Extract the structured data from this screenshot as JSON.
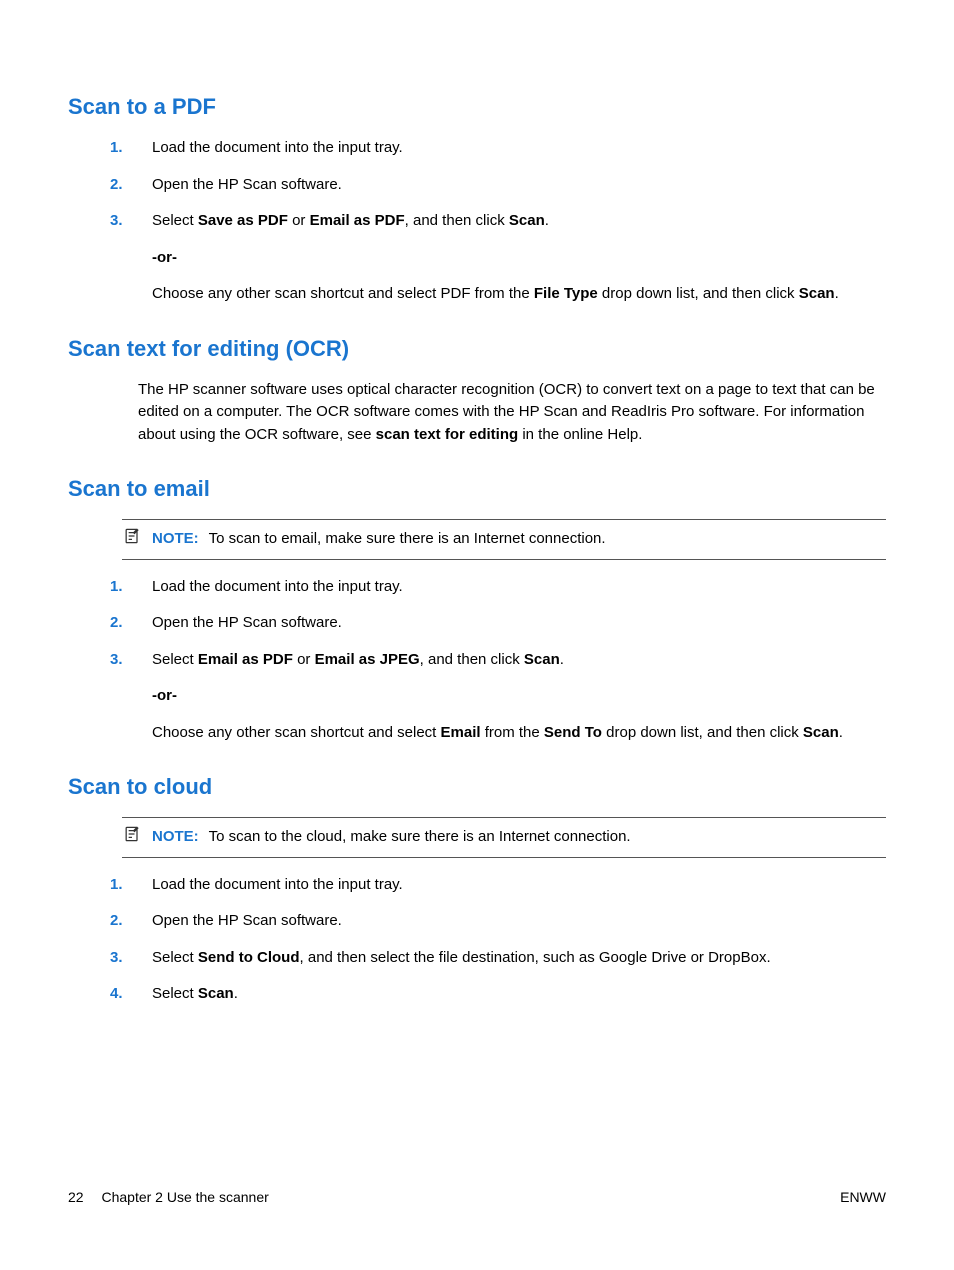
{
  "sections": {
    "pdf": {
      "title": "Scan to a PDF",
      "steps": {
        "s1": "Load the document into the input tray.",
        "s2": "Open the HP Scan software.",
        "s3_1": "Select ",
        "s3_b1": "Save as PDF",
        "s3_2": " or ",
        "s3_b2": "Email as PDF",
        "s3_3": ", and then click ",
        "s3_b3": "Scan",
        "s3_4": "."
      },
      "or": "-or-",
      "alt_1": "Choose any other scan shortcut and select PDF from the ",
      "alt_b1": "File Type",
      "alt_2": " drop down list, and then click ",
      "alt_b2": "Scan",
      "alt_3": "."
    },
    "ocr": {
      "title": "Scan text for editing (OCR)",
      "p1": "The HP scanner software uses optical character recognition (OCR) to convert text on a page to text that can be edited on a computer. The OCR software comes with the HP Scan and ReadIris Pro software. For information about using the OCR software, see ",
      "p1_b": "scan text for editing",
      "p2": " in the online Help."
    },
    "email": {
      "title": "Scan to email",
      "note_label": "NOTE:",
      "note_text": "To scan to email, make sure there is an Internet connection.",
      "steps": {
        "s1": "Load the document into the input tray.",
        "s2": "Open the HP Scan software.",
        "s3_1": "Select ",
        "s3_b1": "Email as PDF",
        "s3_2": " or ",
        "s3_b2": "Email as JPEG",
        "s3_3": ", and then click ",
        "s3_b3": "Scan",
        "s3_4": "."
      },
      "or": "-or-",
      "alt_1": "Choose any other scan shortcut and select ",
      "alt_b1": "Email",
      "alt_2": " from the ",
      "alt_b2": "Send To",
      "alt_3": " drop down list, and then click ",
      "alt_b3": "Scan",
      "alt_4": "."
    },
    "cloud": {
      "title": "Scan to cloud",
      "note_label": "NOTE:",
      "note_text": "To scan to the cloud, make sure there is an Internet connection.",
      "steps": {
        "s1": "Load the document into the input tray.",
        "s2": "Open the HP Scan software.",
        "s3_1": "Select ",
        "s3_b1": "Send to Cloud",
        "s3_2": ", and then select the file destination, such as Google Drive or DropBox.",
        "s4_1": "Select ",
        "s4_b1": "Scan",
        "s4_2": "."
      }
    }
  },
  "nums": {
    "n1": "1.",
    "n2": "2.",
    "n3": "3.",
    "n4": "4."
  },
  "footer": {
    "page": "22",
    "chapter": "Chapter 2   Use the scanner",
    "right": "ENWW"
  }
}
